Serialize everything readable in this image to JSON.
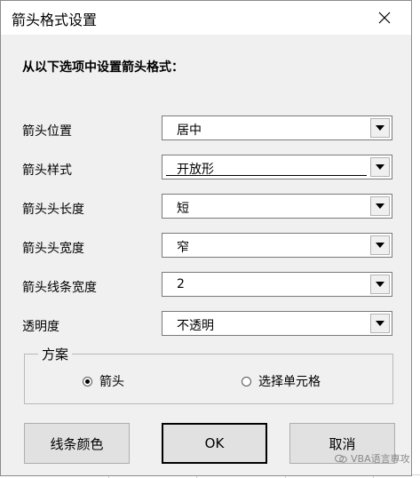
{
  "window": {
    "title": "箭头格式设置"
  },
  "instruction": "从以下选项中设置箭头格式：",
  "fields": [
    {
      "label": "箭头位置",
      "value": "居中"
    },
    {
      "label": "箭头样式",
      "value": "开放形"
    },
    {
      "label": "箭头头长度",
      "value": "短"
    },
    {
      "label": "箭头头宽度",
      "value": "窄"
    },
    {
      "label": "箭头线条宽度",
      "value": "2"
    },
    {
      "label": "透明度",
      "value": "不透明"
    }
  ],
  "scheme": {
    "legend": "方案",
    "options": [
      {
        "label": "箭头",
        "selected": true
      },
      {
        "label": "选择单元格",
        "selected": false
      }
    ]
  },
  "buttons": {
    "line_color": "线条颜色",
    "ok": "OK",
    "cancel": "取消"
  },
  "watermark": "VBA语言専攻"
}
